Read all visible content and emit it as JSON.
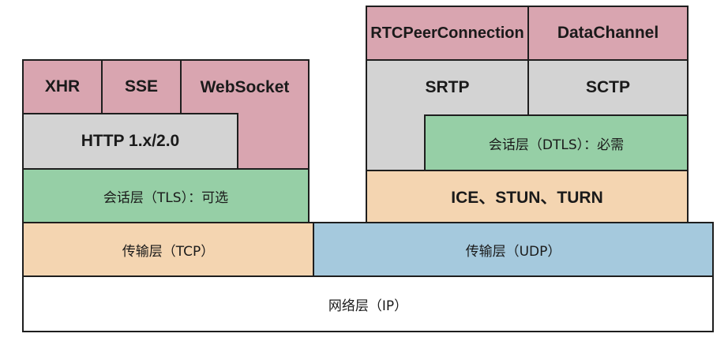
{
  "left_stack": {
    "xhr": "XHR",
    "sse": "SSE",
    "websocket": "WebSocket",
    "http": "HTTP 1.x/2.0",
    "tls": "会话层（TLS）：可选",
    "tcp": "传输层（TCP）"
  },
  "right_stack": {
    "rtcpeerconnection": "RTCPeerConnection",
    "datachannel": "DataChannel",
    "srtp": "SRTP",
    "sctp": "SCTP",
    "dtls": "会话层（DTLS）：必需",
    "ice": "ICE、STUN、TURN",
    "udp": "传输层（UDP）"
  },
  "network": {
    "ip": "网络层（IP）"
  },
  "colors": {
    "api": "#d9a5b0",
    "protocol": "#d3d3d3",
    "session": "#96cfa6",
    "ice_and_tcp": "#f4d5b1",
    "udp": "#a5c9dd",
    "network": "#ffffff"
  }
}
